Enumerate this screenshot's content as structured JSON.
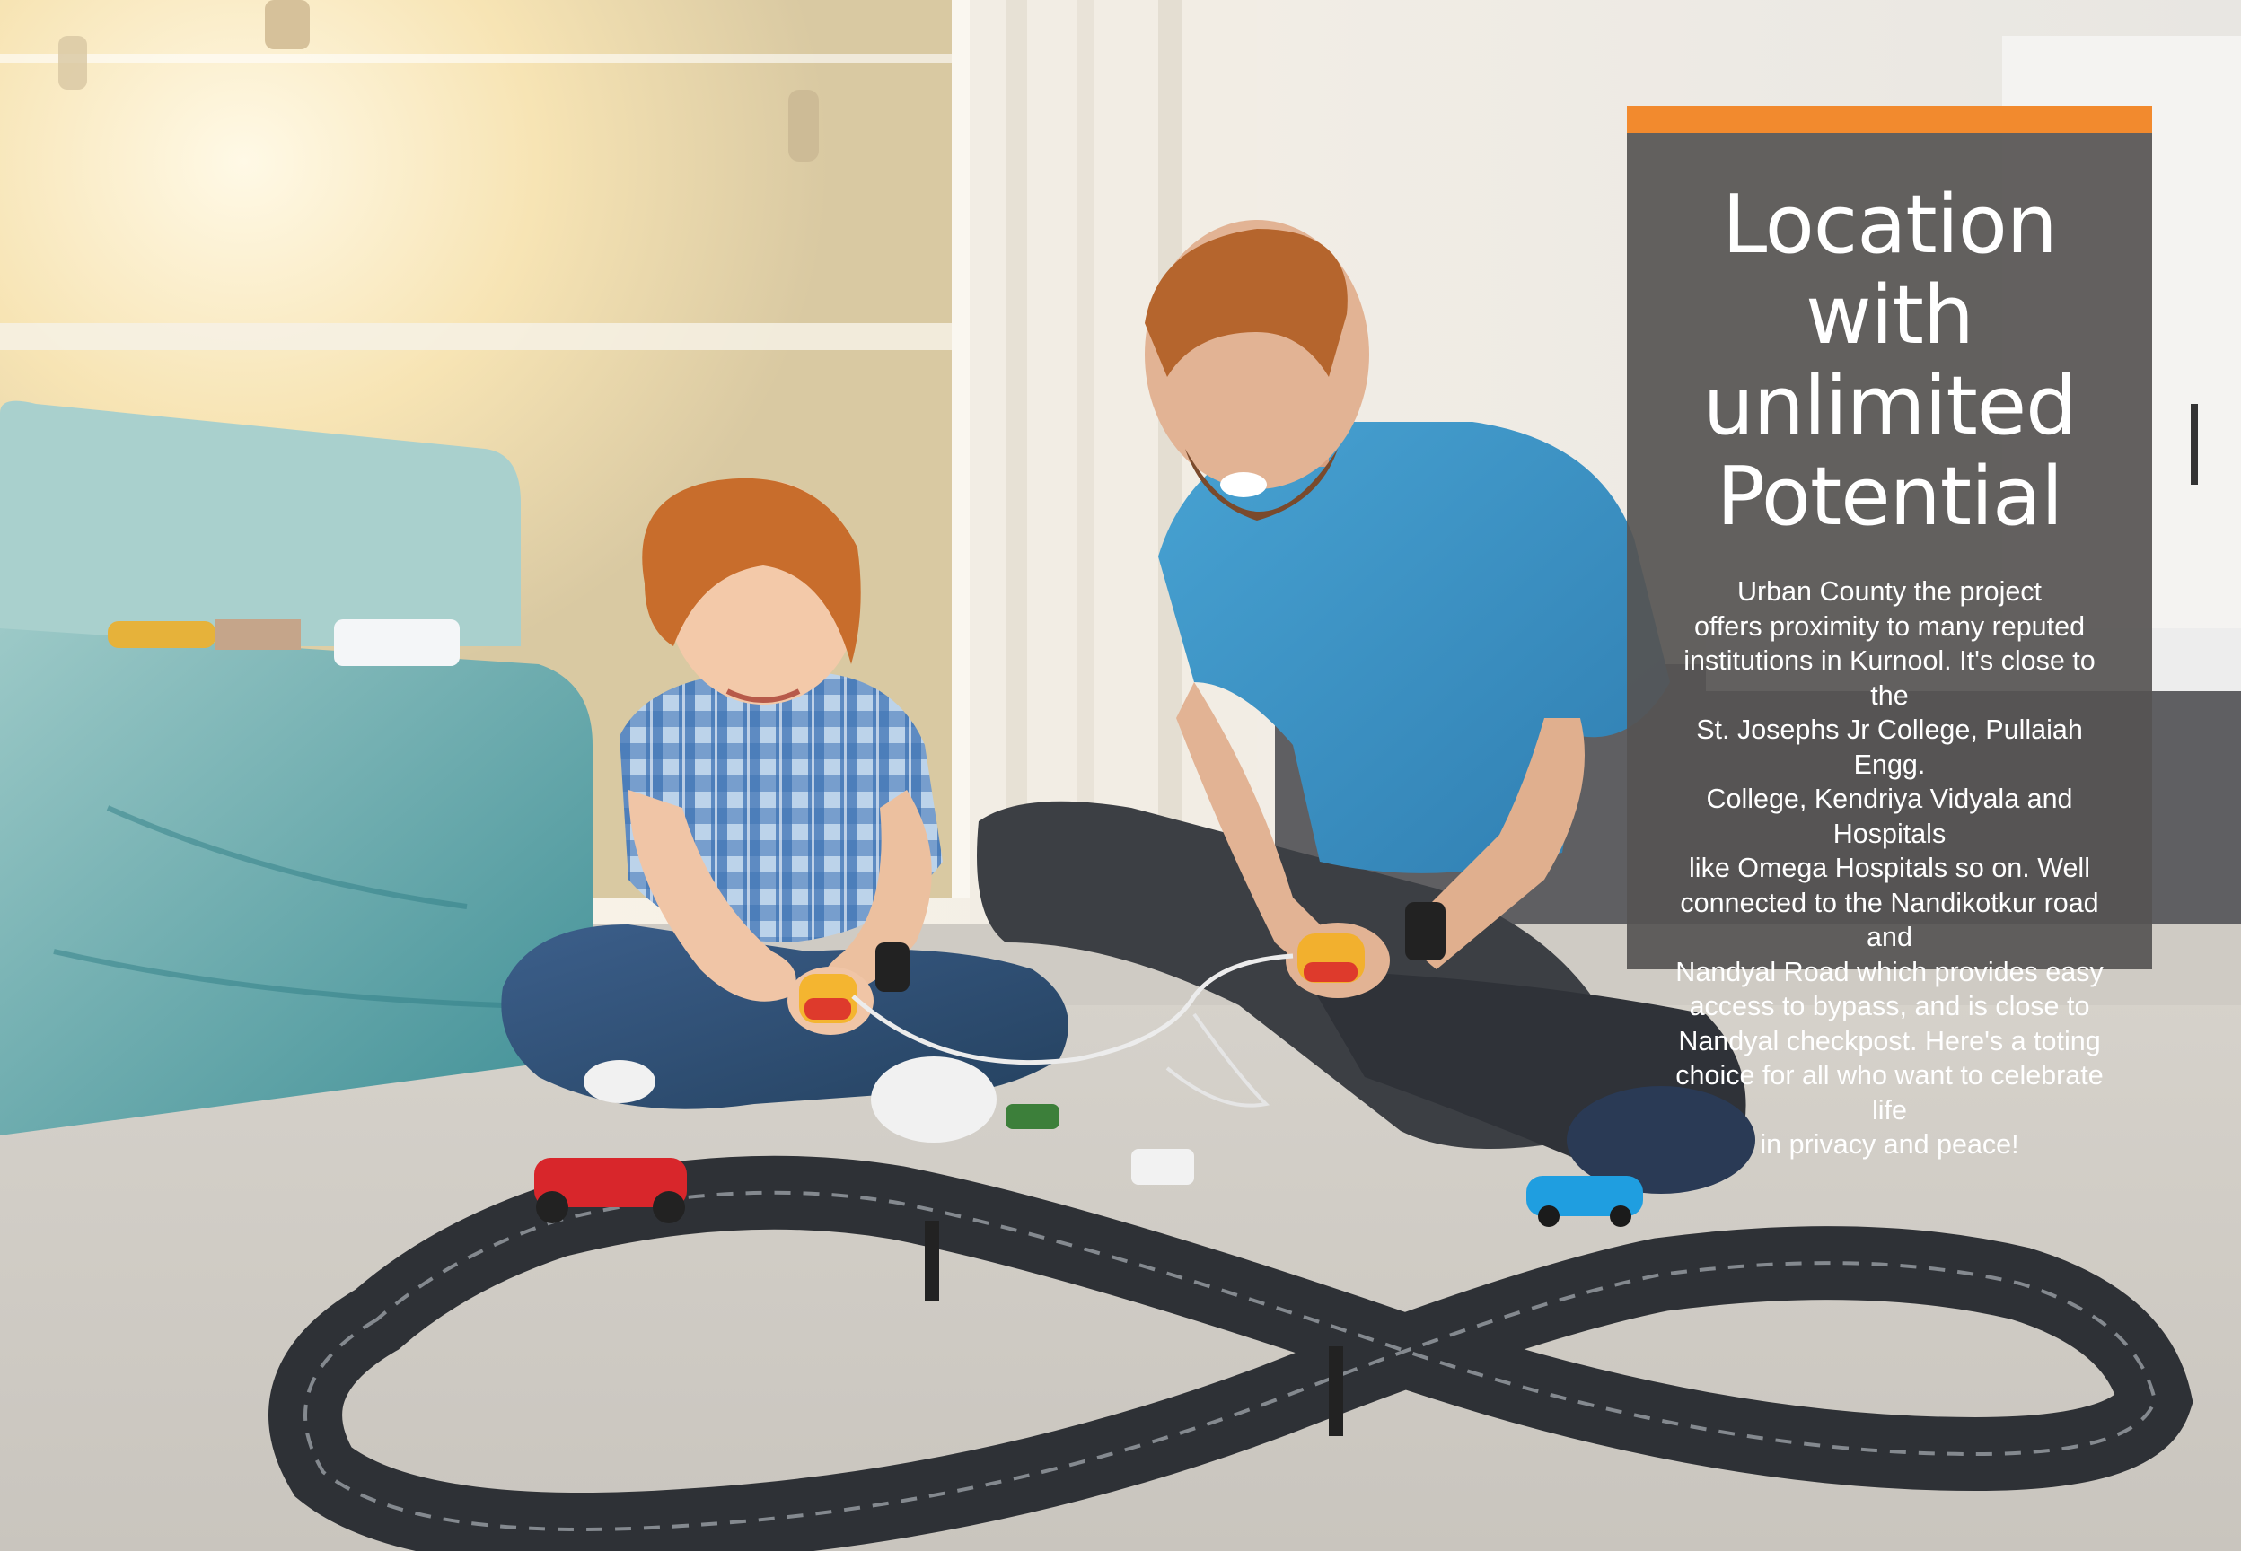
{
  "panel": {
    "title_lines": [
      "Location with",
      "unlimited",
      "Potential"
    ],
    "body": "Urban County the project\noffers proximity to many reputed\ninstitutions in Kurnool.  It's close to the\nSt. Josephs Jr College, Pullaiah Engg.\nCollege, Kendriya Vidyala and Hospitals\nlike Omega Hospitals so on.  Well\nconnected to the Nandikotkur road and\nNandyal Road  which provides easy\naccess to bypass, and is close to\nNandyal checkpost.  Here's a toting\nchoice for all who want  to celebrate life\nin privacy and peace!"
  },
  "colors": {
    "accent": "#f28a2e",
    "panel_background": "#565452",
    "text": "#ffffff"
  },
  "scene": {
    "icons": [
      "photo-father-son-race-track"
    ]
  }
}
